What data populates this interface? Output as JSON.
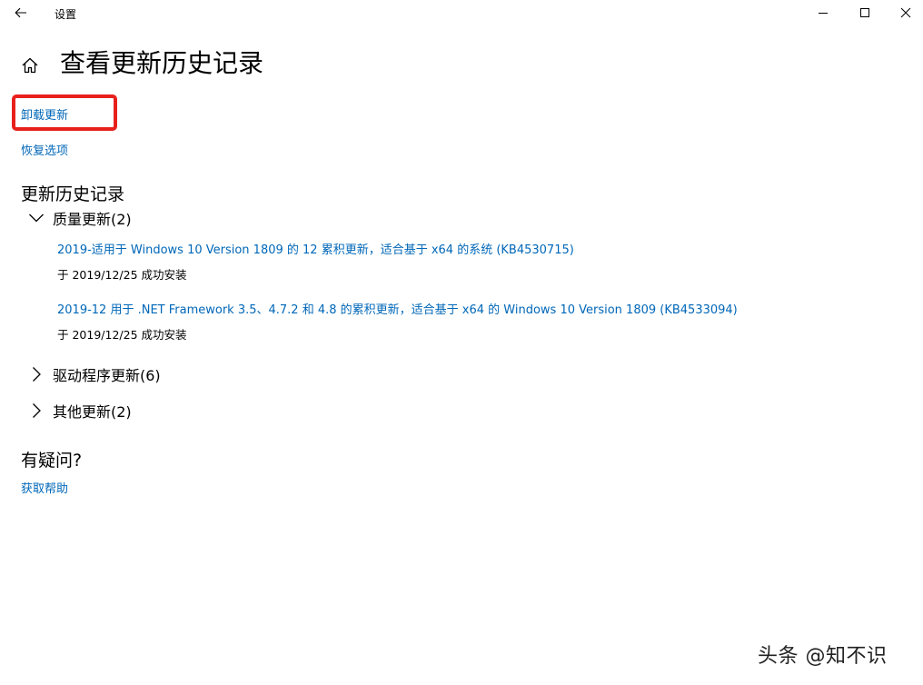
{
  "titlebar": {
    "app_title": "设置",
    "back_icon": "back-arrow-icon",
    "minimize_icon": "minimize-icon",
    "maximize_icon": "maximize-icon",
    "close_icon": "close-icon"
  },
  "header": {
    "home_icon": "home-icon",
    "title": "查看更新历史记录"
  },
  "links": {
    "uninstall": "卸载更新",
    "recovery": "恢复选项"
  },
  "history": {
    "heading": "更新历史记录",
    "groups": [
      {
        "label": "质量更新(2)",
        "expanded": true,
        "items": [
          {
            "title": "2019-适用于 Windows 10 Version 1809 的 12 累积更新，适合基于 x64 的系统 (KB4530715)",
            "status": "于 2019/12/25 成功安装"
          },
          {
            "title": "2019-12 用于 .NET Framework 3.5、4.7.2 和 4.8 的累积更新，适合基于 x64 的 Windows 10 Version 1809 (KB4533094)",
            "status": "于 2019/12/25 成功安装"
          }
        ]
      },
      {
        "label": "驱动程序更新(6)",
        "expanded": false
      },
      {
        "label": "其他更新(2)",
        "expanded": false
      }
    ]
  },
  "help": {
    "heading": "有疑问?",
    "link": "获取帮助"
  },
  "watermark": "头条 @知不识",
  "colors": {
    "link": "#0067b8",
    "highlight": "#e8201c"
  }
}
